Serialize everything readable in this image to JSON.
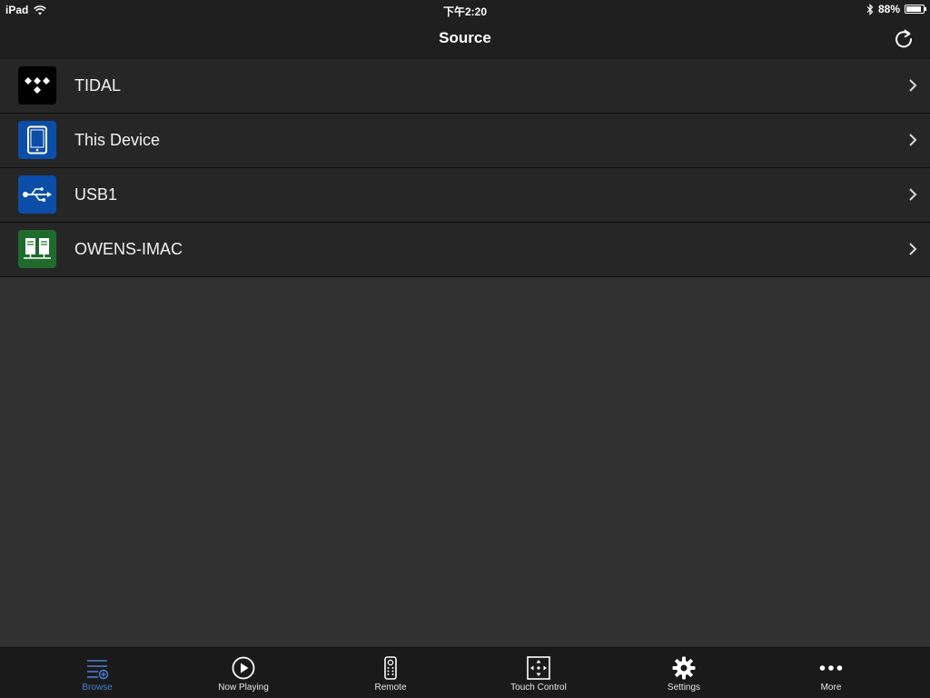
{
  "status_bar": {
    "device": "iPad",
    "time": "下午2:20",
    "battery_percent_label": "88%",
    "battery_level": 0.88
  },
  "nav": {
    "title": "Source"
  },
  "sources": [
    {
      "label": "TIDAL",
      "icon": "tidal-logo-icon"
    },
    {
      "label": "This Device",
      "icon": "tablet-icon"
    },
    {
      "label": "USB1",
      "icon": "usb-icon"
    },
    {
      "label": "OWENS-IMAC",
      "icon": "media-server-icon"
    }
  ],
  "tabs": [
    {
      "label": "Browse",
      "icon": "browse-list-icon",
      "active": true
    },
    {
      "label": "Now Playing",
      "icon": "play-circle-icon",
      "active": false
    },
    {
      "label": "Remote",
      "icon": "remote-control-icon",
      "active": false
    },
    {
      "label": "Touch Control",
      "icon": "touch-control-icon",
      "active": false
    },
    {
      "label": "Settings",
      "icon": "gear-icon",
      "active": false
    },
    {
      "label": "More",
      "icon": "more-dots-icon",
      "active": false
    }
  ],
  "colors": {
    "accent": "#4a7fd6",
    "background": "#313131",
    "bar": "#1f1f1f",
    "row": "#262626"
  }
}
